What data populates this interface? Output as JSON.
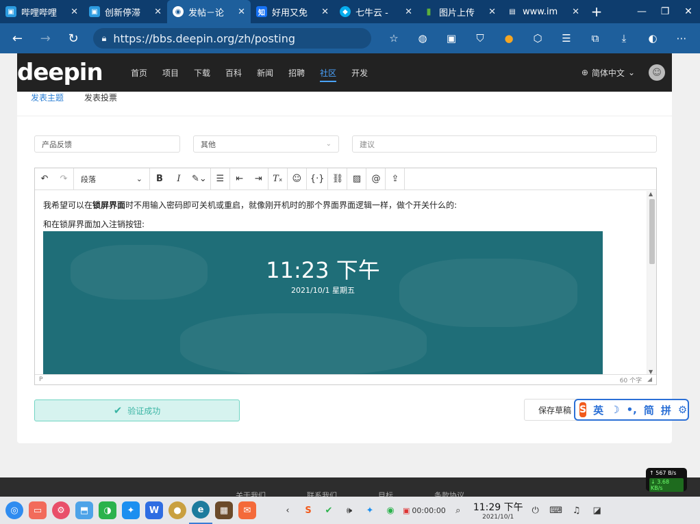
{
  "browser": {
    "tabs": [
      {
        "title": "哔哩哔哩",
        "icon": "bilibili-icon",
        "color": "#2b9be0",
        "active": false
      },
      {
        "title": "创新停滞",
        "icon": "bilibili-icon",
        "color": "#2b9be0",
        "active": false
      },
      {
        "title": "发帖－论",
        "icon": "deepin-icon",
        "color": "#ffffff",
        "active": true
      },
      {
        "title": "好用又免",
        "icon": "zhihu-icon",
        "color": "#1772f6",
        "active": false
      },
      {
        "title": "七牛云 -",
        "icon": "qiniu-icon",
        "color": "#06aeef",
        "active": false
      },
      {
        "title": "图片上传",
        "icon": "chart-icon",
        "color": "#5db03c",
        "active": false
      },
      {
        "title": "www.im",
        "icon": "file-icon",
        "color": "#ffffff",
        "active": false
      }
    ],
    "new_tab": "+",
    "url": "https://bbs.deepin.org/zh/posting"
  },
  "site": {
    "logo": "deepin",
    "nav": [
      "首页",
      "项目",
      "下载",
      "百科",
      "新闻",
      "招聘",
      "社区",
      "开发"
    ],
    "active_nav": "社区",
    "language": "简体中文"
  },
  "posting": {
    "tabs": [
      "发表主题",
      "发表投票"
    ],
    "category": "产品反馈",
    "subcategory": "其他",
    "tag_placeholder": "建议",
    "toolbar": {
      "block_format": "段落"
    },
    "content": {
      "line1_before": "我希望可以在",
      "line1_bold": "锁屏界面",
      "line1_after": "时不用输入密码即可关机或重启，就像刚开机时的那个界面界面逻辑一样，做个开关什么的:",
      "line2": "和在锁屏界面加入注销按钮:",
      "screenshot_time": "11:23 下午",
      "screenshot_date": "2021/10/1 星期五"
    },
    "status_path": "P",
    "word_count": "60 个字",
    "verify_label": "验证成功",
    "draft_label": "保存草稿"
  },
  "ime": {
    "mode": "英",
    "simplified": "简",
    "pinyin": "拼"
  },
  "footer": [
    "关于我们",
    "联系我们",
    "目标",
    "条款协议"
  ],
  "netspeed": {
    "up": "567 B/s",
    "down": "3.68 KB/s"
  },
  "taskbar": {
    "recording_time": "00:00:00",
    "time": "11:29 下午",
    "date": "2021/10/1"
  },
  "colors": {
    "accent": "#2b7fd5",
    "success": "#3ab5a4",
    "header_bg": "#222222",
    "browser_bg": "#1e5f9c"
  }
}
